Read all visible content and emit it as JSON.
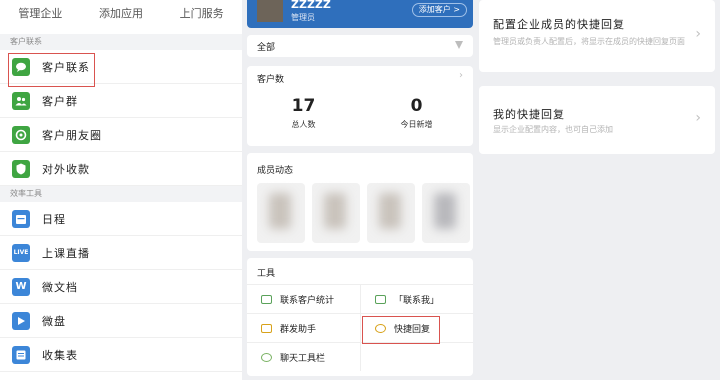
{
  "left": {
    "topbar": [
      "管理企业",
      "添加应用",
      "上门服务"
    ],
    "section1": "客户联系",
    "items1": [
      {
        "label": "客户联系",
        "icon": "chat-icon",
        "color": "#3fa542"
      },
      {
        "label": "客户群",
        "icon": "group-icon",
        "color": "#3fa542"
      },
      {
        "label": "客户朋友圈",
        "icon": "moments-icon",
        "color": "#3fa542"
      },
      {
        "label": "对外收款",
        "icon": "payment-icon",
        "color": "#3fa542"
      }
    ],
    "section2": "效率工具",
    "items2": [
      {
        "label": "日程",
        "icon": "calendar-icon",
        "color": "#3c86d8"
      },
      {
        "label": "上课直播",
        "icon": "live-icon",
        "glyph": "LIVE",
        "color": "#3c86d8"
      },
      {
        "label": "微文档",
        "icon": "document-icon",
        "glyph": "W",
        "color": "#3c86d8"
      },
      {
        "label": "微盘",
        "icon": "drive-icon",
        "color": "#3c86d8"
      },
      {
        "label": "收集表",
        "icon": "form-icon",
        "color": "#3c86d8"
      }
    ]
  },
  "mid": {
    "header": {
      "username": "ZZZZZ",
      "role": "管理员",
      "add_button": "添加客户 >"
    },
    "all_label": "全部",
    "stats": {
      "title": "客户数",
      "total": {
        "value": "17",
        "label": "总人数"
      },
      "today": {
        "value": "0",
        "label": "今日新增"
      }
    },
    "members_title": "成员动态",
    "tools": {
      "title": "工具",
      "items": [
        {
          "label": "联系客户统计",
          "icon": "stats-icon"
        },
        {
          "label": "「联系我」",
          "icon": "contact-me-icon"
        },
        {
          "label": "群发助手",
          "icon": "broadcast-icon"
        },
        {
          "label": "快捷回复",
          "icon": "quick-reply-icon"
        },
        {
          "label": "聊天工具栏",
          "icon": "chat-toolbar-icon"
        }
      ]
    }
  },
  "right": {
    "card1": {
      "title": "配置企业成员的快捷回复",
      "desc": "管理员或负责人配置后，将显示在成员的快捷回复页面"
    },
    "card2": {
      "title": "我的快捷回复",
      "desc": "显示企业配置内容，也可自己添加"
    }
  },
  "colors": {
    "accent": "#2f6fbc",
    "highlight": "#d9534f",
    "green": "#3fa542",
    "blue": "#3c86d8"
  }
}
